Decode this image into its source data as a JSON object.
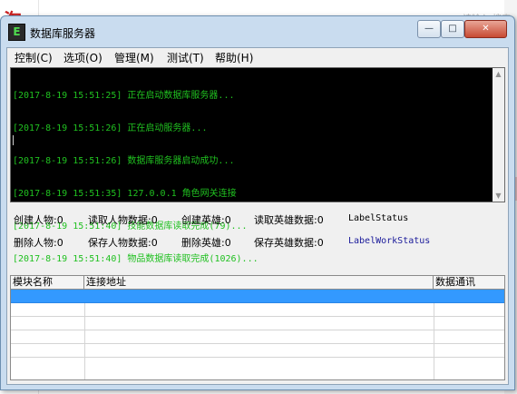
{
  "background": {
    "logo_glyph": "淘",
    "search_text": "请输入 搜索"
  },
  "window": {
    "title": "数据库服务器",
    "icon_letter": "E",
    "controls": {
      "minimize": "—",
      "maximize": "□",
      "close": "✕"
    }
  },
  "menu": [
    {
      "label": "控制(C)"
    },
    {
      "label": "选项(O)"
    },
    {
      "label": "管理(M)"
    },
    {
      "label": "测试(T)"
    },
    {
      "label": "帮助(H)"
    }
  ],
  "log": {
    "text_color": "#20c020",
    "lines": [
      "[2017-8-19 15:51:25] 正在启动数据库服务器...",
      "[2017-8-19 15:51:26] 正在启动服务器...",
      "[2017-8-19 15:51:26] 数据库服务器启动成功...",
      "[2017-8-19 15:51:35] 127.0.0.1 角色网关连接",
      "[2017-8-19 15:51:40] 技能数据库读取完成(79)...",
      "[2017-8-19 15:51:40] 物品数据库读取完成(1026)..."
    ]
  },
  "stats": {
    "row1": {
      "create_char": "创建人物:0",
      "read_char": "读取人物数据:0",
      "create_hero": "创建英雄:0",
      "read_hero": "读取英雄数据:0",
      "status": "LabelStatus"
    },
    "row2": {
      "delete_char": "删除人物:0",
      "save_char": "保存人物数据:0",
      "delete_hero": "删除英雄:0",
      "save_hero": "保存英雄数据:0",
      "work_status": "LabelWorkStatus"
    }
  },
  "grid": {
    "columns": [
      "模块名称",
      "连接地址",
      "数据通讯"
    ],
    "selected_row_color": "#3399ff"
  }
}
